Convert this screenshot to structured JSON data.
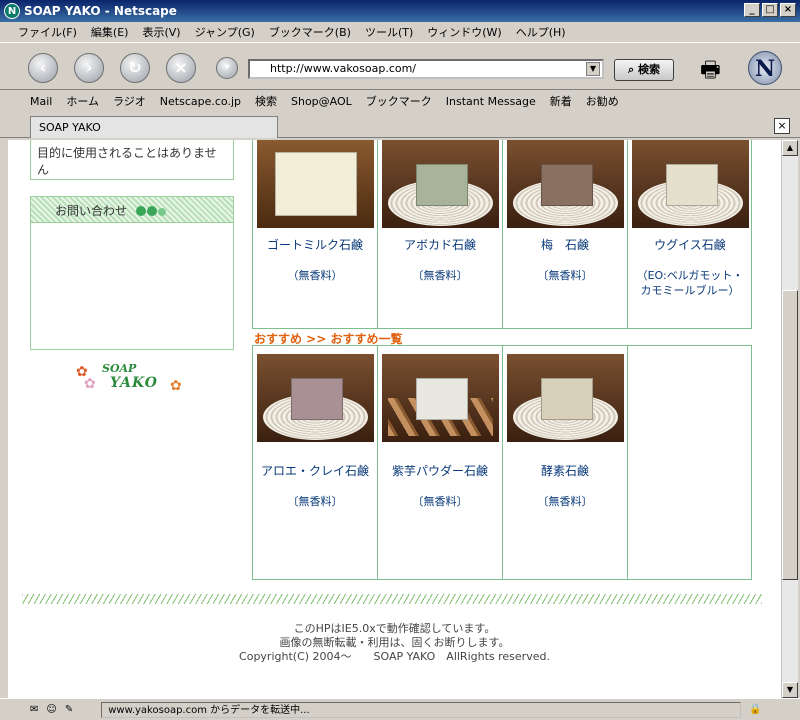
{
  "window": {
    "title": "SOAP YAKO - Netscape"
  },
  "menu": [
    "ファイル(F)",
    "編集(E)",
    "表示(V)",
    "ジャンプ(G)",
    "ブックマーク(B)",
    "ツール(T)",
    "ウィンドウ(W)",
    "ヘルプ(H)"
  ],
  "nav": {
    "url": "http://www.vakosoap.com/",
    "search_label": "検索"
  },
  "personal_toolbar": [
    "Mail",
    "ホーム",
    "ラジオ",
    "Netscape.co.jp",
    "検索",
    "Shop@AOL",
    "ブックマーク",
    "Instant Message",
    "新着",
    "お勧め"
  ],
  "tab": {
    "label": "SOAP YAKO"
  },
  "sidebar": {
    "notice_text": "目的に使用されることはありません",
    "contact_heading": "お問い合わせ",
    "logo_line1": "SOAP",
    "logo_line2": "YAKO"
  },
  "products_row1": [
    {
      "name": "ゴートミルク石鹸",
      "note": "（無香料）",
      "soap_color": "#f2eed8",
      "base": "none"
    },
    {
      "name": "アボカド石鹸",
      "note": "〔無香料〕",
      "soap_color": "#a8b49a",
      "base": "mat"
    },
    {
      "name": "梅　石鹸",
      "note": "〔無香料〕",
      "soap_color": "#8a7060",
      "base": "mat"
    },
    {
      "name": "ウグイス石鹸",
      "note": "（EO:ベルガモット・カモミールブルー）",
      "soap_color": "#e4e0cc",
      "base": "mat"
    }
  ],
  "section_link": "おすすめ >> おすすめ一覧",
  "products_row2": [
    {
      "name": "アロエ・クレイ石鹸",
      "note": "〔無香料〕",
      "soap_color": "#a89094",
      "base": "mat"
    },
    {
      "name": "紫芋パウダー石鹸",
      "note": "〔無香料〕",
      "soap_color": "#e8e8e0",
      "base": "wood"
    },
    {
      "name": "酵素石鹸",
      "note": "〔無香料〕",
      "soap_color": "#d8d0b8",
      "base": "mat"
    }
  ],
  "footer": {
    "line1": "このHPはIE5.0xで動作確認しています。",
    "line2": "画像の無断転載・利用は、固くお断りします。",
    "line3": "Copyright(C) 2004～　　SOAP YAKO　AllRights reserved."
  },
  "status": {
    "text": "www.yakosoap.com からデータを転送中..."
  },
  "colors": {
    "table_border": "#7fbf8f",
    "link_orange": "#e06010",
    "product_text": "#0a3a7a"
  }
}
